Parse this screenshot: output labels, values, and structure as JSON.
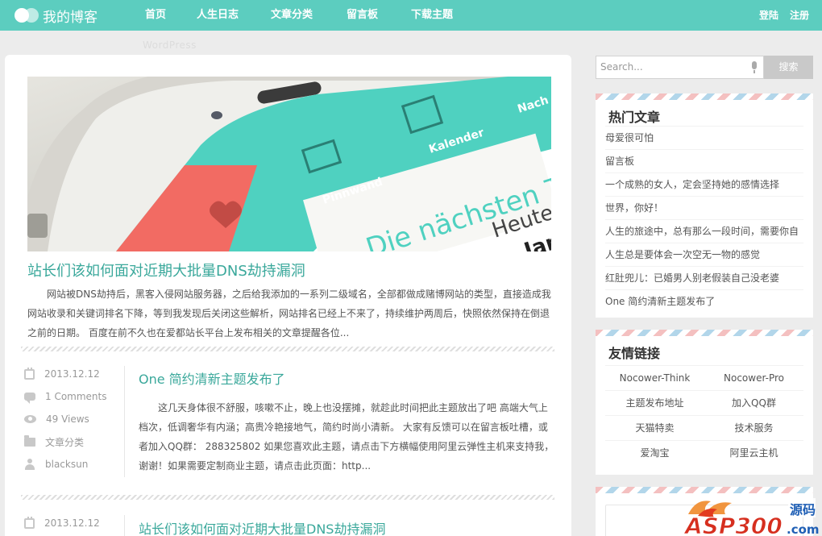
{
  "site": {
    "title": "我的博客"
  },
  "nav": {
    "items": [
      "首页",
      "人生日志",
      "文章分类",
      "留言板",
      "下载主题"
    ],
    "subtitle": "WordPress",
    "login": "登陆",
    "register": "注册"
  },
  "featured": {
    "image": {
      "tab1": "Pinnwand",
      "tab2": "Kalender",
      "tab3": "Nach",
      "headline": "Die nächsten T",
      "today": "Heute",
      "name": "Jan"
    },
    "title": "站长们该如何面对近期大批量DNS劫持漏洞",
    "excerpt": "网站被DNS劫持后，黑客入侵网站服务器，之后给我添加的一系列二级域名，全部都做成赌博网站的类型，直接造成我网站收录和关键词排名下降，等到我发现后关闭这些解析，网站排名已经上不来了，持续维护两周后，快照依然保持在倒退之前的日期。 百度在前不久也在爱都站长平台上发布相关的文章提醒各位..."
  },
  "posts": [
    {
      "date": "2013.12.12",
      "comments": "1 Comments",
      "views": "49 Views",
      "category": "文章分类",
      "author": "blacksun",
      "title": "One 简约清新主题发布了",
      "excerpt": "这几天身体很不舒服，咳嗽不止，晚上也没摆摊，就趁此时间把此主题放出了吧 高端大气上档次，低调奢华有内涵；高贵冷艳接地气，简约时尚小清新。 大家有反馈可以在留言板吐槽，或者加入QQ群： 288325802 如果您喜欢此主题，请点击下方横幅使用阿里云弹性主机来支持我，谢谢！如果需要定制商业主题，请点击此页面：http..."
    },
    {
      "date": "2013.12.12",
      "title": "站长们该如何面对近期大批量DNS劫持漏洞"
    }
  ],
  "search": {
    "placeholder": "Search...",
    "button": "搜索"
  },
  "hot": {
    "title": "热门文章",
    "items": [
      "母爱很可怕",
      "留言板",
      "一个成熟的女人，定会坚持她的感情选择",
      "世界，你好！",
      "人生的旅途中，总有那么一段时间，需要你自",
      "人生总是要体会一次空无一物的感觉",
      "红肚兜儿：已婚男人别老假装自己没老婆",
      "One 简约清新主题发布了"
    ]
  },
  "links": {
    "title": "友情链接",
    "items": [
      "Nocower-Think",
      "Nocower-Pro",
      "主题发布地址",
      "加入QQ群",
      "天猫特卖",
      "技术服务",
      "爱淘宝",
      "阿里云主机"
    ]
  },
  "watermark": {
    "brand": "ASP300",
    "tag": "源码",
    "domain": ".com"
  },
  "colors": {
    "accent": "#5ccdbf",
    "link": "#3aa89b"
  }
}
